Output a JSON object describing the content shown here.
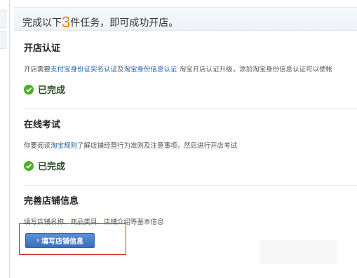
{
  "header": {
    "title_prefix": "完成以下",
    "title_count": "3",
    "title_suffix": "件任务，即可成功开店。"
  },
  "sections": [
    {
      "title": "开店认证",
      "desc_prefix": "开店需要",
      "link1": "支付宝身份证实名认证",
      "desc_mid": "及",
      "link2": "淘宝身份信息认证",
      "desc_suffix": " 淘宝开店认证升级，添加淘宝身份信息认证可以使帐",
      "status": "已完成"
    },
    {
      "title": "在线考试",
      "desc_prefix": "你要阅读",
      "link1": "淘宝规则",
      "desc_suffix": "了解店铺经营行为准则及注意事项，然后进行开店考试",
      "status": "已完成"
    },
    {
      "title": "完善店铺信息",
      "desc": "填写店铺名称、商品类目、店铺介绍等基本信息",
      "button_arrow": "›",
      "button_label": "填写店铺信息"
    }
  ],
  "colors": {
    "accent_orange": "#f08000",
    "link_blue": "#1f5ea8",
    "success_green": "#4caf2a",
    "highlight_red": "#d42a2a",
    "button_blue": "#3a6fbd"
  },
  "icons": {
    "status": "check-circle-icon",
    "button": "chevron-right-icon"
  }
}
